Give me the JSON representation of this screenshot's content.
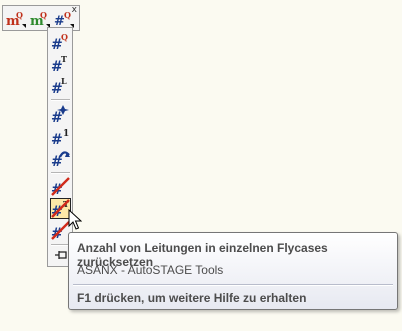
{
  "toolbar": {
    "close_label": "x",
    "buttons": [
      {
        "name": "mq-button",
        "glyph": "m",
        "sup": "Q",
        "color": "#c0311c"
      },
      {
        "name": "mq-green-button",
        "glyph": "m",
        "sup": "Q",
        "color": "#2e8a2e"
      },
      {
        "name": "hash-dropdown-button",
        "glyph": "#",
        "sup": "Q",
        "color": "#1a3c8c"
      }
    ]
  },
  "dropdown": {
    "items": [
      {
        "name": "hash-q",
        "sup": "Q"
      },
      {
        "name": "hash-t",
        "sup": "T"
      },
      {
        "name": "hash-l",
        "sup": "L"
      },
      {
        "name": "hash-plus",
        "sup": "+"
      },
      {
        "name": "hash-1",
        "sup": "1"
      },
      {
        "name": "hash-arrow",
        "sup": ""
      },
      {
        "name": "hash-reset",
        "sup": ""
      },
      {
        "name": "hash-reset-flycase",
        "sup": "T"
      },
      {
        "name": "hash-reset-x",
        "sup": "x"
      }
    ]
  },
  "tooltip": {
    "title": "Anzahl von Leitungen in einzelnen Flycases zurücksetzen",
    "description": "ASANX - AutoSTAGE Tools",
    "help": "F1 drücken, um weitere Hilfe zu erhalten"
  },
  "colors": {
    "background": "#fbfaf1",
    "hash_blue": "#1a3c8c",
    "accent_red": "#c0311c",
    "pressed_bg": "#fde9a8"
  }
}
